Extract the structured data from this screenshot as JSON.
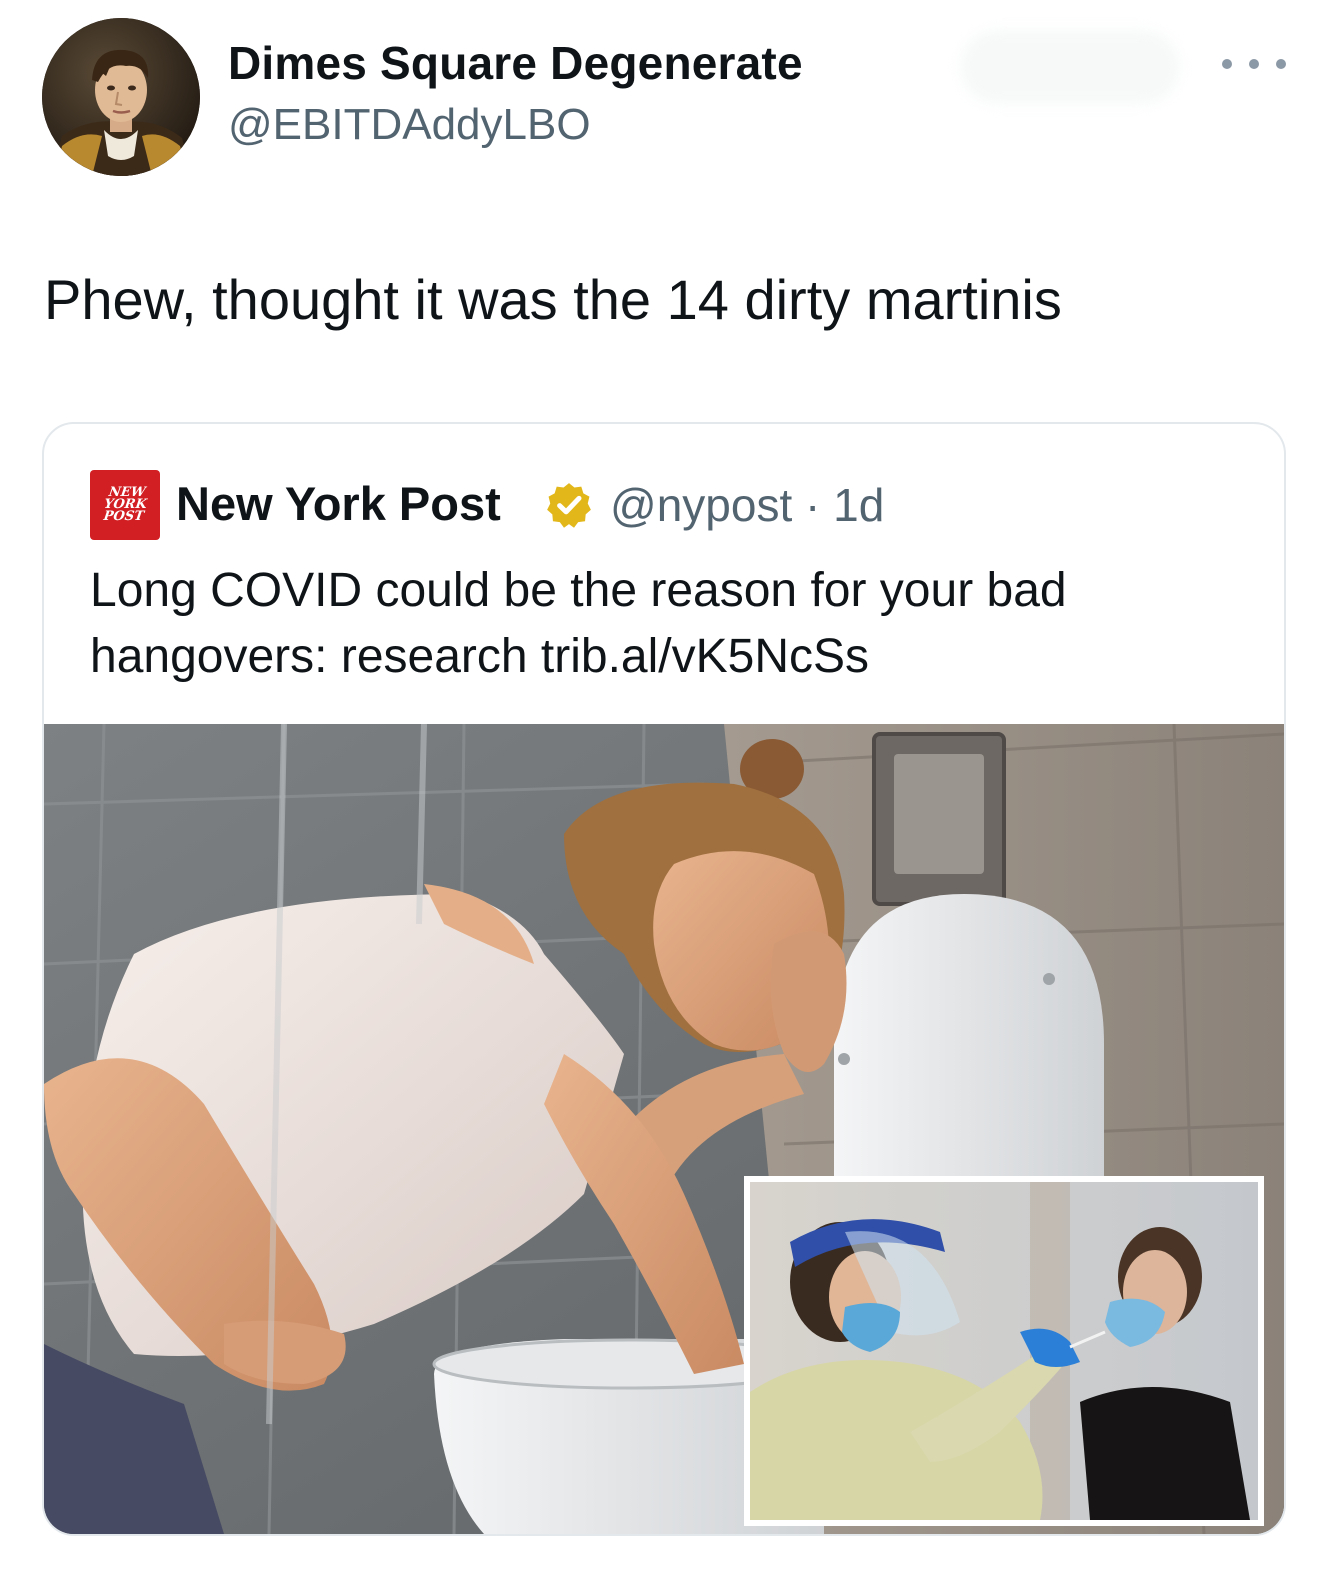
{
  "tweet": {
    "author": {
      "display_name": "Dimes Square Degenerate",
      "handle": "@EBITDAddyLBO",
      "avatar_icon": "portrait-avatar-icon"
    },
    "more_icon": "more-horizontal-icon",
    "text": "Phew, thought it was the 14 dirty martinis"
  },
  "quote": {
    "source_logo_text": "NEW\nYORK\nPOST",
    "source_logo_color": "#d21f23",
    "name": "New York Post",
    "verified_icon": "verified-gold-badge-icon",
    "handle_time": "@nypost · 1d",
    "text_lines": [
      "Long COVID could be the reason for your bad",
      "hangovers: research trib.al/vK5NcSs"
    ],
    "media": {
      "main_image": "woman-leaning-over-toilet-photo",
      "inset_image": "covid-swab-test-photo"
    }
  },
  "colors": {
    "text_primary": "#0f1419",
    "text_secondary": "#536471",
    "verified_gold": "#e2b719",
    "card_border": "#e3e8ec"
  }
}
